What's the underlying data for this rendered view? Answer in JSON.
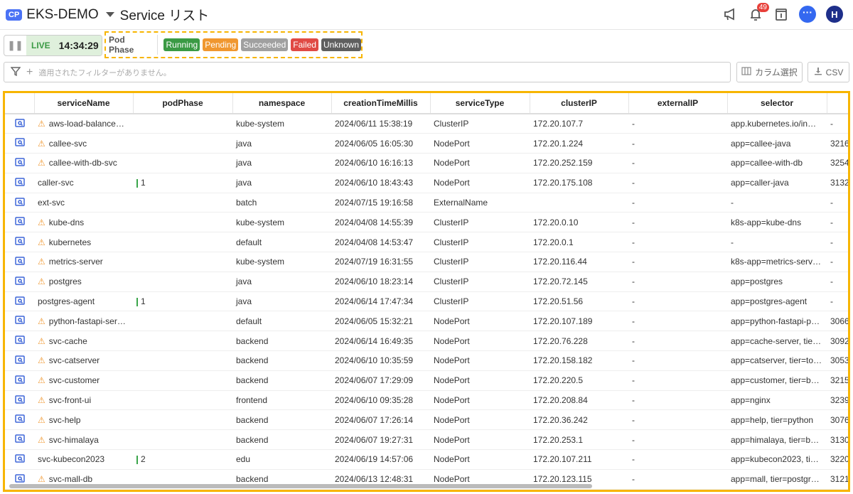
{
  "header": {
    "badge": "CP",
    "project": "EKS-DEMO",
    "title": "Service リスト",
    "notification_count": "49",
    "avatar": "H"
  },
  "live": {
    "label": "LIVE",
    "time": "14:34:29"
  },
  "pod_phase": {
    "label": "Pod Phase",
    "chips": [
      {
        "label": "Running",
        "color": "#3a9a44"
      },
      {
        "label": "Pending",
        "color": "#f0972f"
      },
      {
        "label": "Succeeded",
        "color": "#a0a0a0"
      },
      {
        "label": "Failed",
        "color": "#e04a44"
      },
      {
        "label": "Unknown",
        "color": "#5f5f5f"
      }
    ]
  },
  "filter": {
    "placeholder": "適用されたフィルターがありません。"
  },
  "toolbar": {
    "columns_label": "カラム選択",
    "csv_label": "CSV"
  },
  "table": {
    "columns": [
      "",
      "serviceName",
      "podPhase",
      "namespace",
      "creationTimeMillis",
      "serviceType",
      "clusterIP",
      "externalIP",
      "selector",
      ""
    ],
    "rows": [
      {
        "warn": true,
        "name": "aws-load-balance…",
        "pod": "",
        "ns": "kube-system",
        "created": "2024/06/11 15:38:19",
        "type": "ClusterIP",
        "ip": "172.20.107.7",
        "ext": "-",
        "sel": "app.kubernetes.io/in…",
        "last": "-"
      },
      {
        "warn": true,
        "name": "callee-svc",
        "pod": "",
        "ns": "java",
        "created": "2024/06/05 16:05:30",
        "type": "NodePort",
        "ip": "172.20.1.224",
        "ext": "-",
        "sel": "app=callee-java",
        "last": "3216"
      },
      {
        "warn": true,
        "name": "callee-with-db-svc",
        "pod": "",
        "ns": "java",
        "created": "2024/06/10 16:16:13",
        "type": "NodePort",
        "ip": "172.20.252.159",
        "ext": "-",
        "sel": "app=callee-with-db",
        "last": "3254"
      },
      {
        "warn": false,
        "name": "caller-svc",
        "pod": "1",
        "ns": "java",
        "created": "2024/06/10 18:43:43",
        "type": "NodePort",
        "ip": "172.20.175.108",
        "ext": "-",
        "sel": "app=caller-java",
        "last": "3132"
      },
      {
        "warn": false,
        "name": "ext-svc",
        "pod": "",
        "ns": "batch",
        "created": "2024/07/15 19:16:58",
        "type": "ExternalName",
        "ip": "",
        "ext": "-",
        "sel": "-",
        "last": "-"
      },
      {
        "warn": true,
        "name": "kube-dns",
        "pod": "",
        "ns": "kube-system",
        "created": "2024/04/08 14:55:39",
        "type": "ClusterIP",
        "ip": "172.20.0.10",
        "ext": "-",
        "sel": "k8s-app=kube-dns",
        "last": "-"
      },
      {
        "warn": true,
        "name": "kubernetes",
        "pod": "",
        "ns": "default",
        "created": "2024/04/08 14:53:47",
        "type": "ClusterIP",
        "ip": "172.20.0.1",
        "ext": "-",
        "sel": "-",
        "last": "-"
      },
      {
        "warn": true,
        "name": "metrics-server",
        "pod": "",
        "ns": "kube-system",
        "created": "2024/07/19 16:31:55",
        "type": "ClusterIP",
        "ip": "172.20.116.44",
        "ext": "-",
        "sel": "k8s-app=metrics-serv…",
        "last": "-"
      },
      {
        "warn": true,
        "name": "postgres",
        "pod": "",
        "ns": "java",
        "created": "2024/06/10 18:23:14",
        "type": "ClusterIP",
        "ip": "172.20.72.145",
        "ext": "-",
        "sel": "app=postgres",
        "last": "-"
      },
      {
        "warn": false,
        "name": "postgres-agent",
        "pod": "1",
        "ns": "java",
        "created": "2024/06/14 17:47:34",
        "type": "ClusterIP",
        "ip": "172.20.51.56",
        "ext": "-",
        "sel": "app=postgres-agent",
        "last": "-"
      },
      {
        "warn": true,
        "name": "python-fastapi-ser…",
        "pod": "",
        "ns": "default",
        "created": "2024/06/05 15:32:21",
        "type": "NodePort",
        "ip": "172.20.107.189",
        "ext": "-",
        "sel": "app=python-fastapi-p…",
        "last": "3066"
      },
      {
        "warn": true,
        "name": "svc-cache",
        "pod": "",
        "ns": "backend",
        "created": "2024/06/14 16:49:35",
        "type": "NodePort",
        "ip": "172.20.76.228",
        "ext": "-",
        "sel": "app=cache-server, tie…",
        "last": "3092"
      },
      {
        "warn": true,
        "name": "svc-catserver",
        "pod": "",
        "ns": "backend",
        "created": "2024/06/10 10:35:59",
        "type": "NodePort",
        "ip": "172.20.158.182",
        "ext": "-",
        "sel": "app=catserver, tier=to…",
        "last": "3053"
      },
      {
        "warn": true,
        "name": "svc-customer",
        "pod": "",
        "ns": "backend",
        "created": "2024/06/07 17:29:09",
        "type": "NodePort",
        "ip": "172.20.220.5",
        "ext": "-",
        "sel": "app=customer, tier=b…",
        "last": "3215"
      },
      {
        "warn": true,
        "name": "svc-front-ui",
        "pod": "",
        "ns": "frontend",
        "created": "2024/06/10 09:35:28",
        "type": "NodePort",
        "ip": "172.20.208.84",
        "ext": "-",
        "sel": "app=nginx",
        "last": "3239"
      },
      {
        "warn": true,
        "name": "svc-help",
        "pod": "",
        "ns": "backend",
        "created": "2024/06/07 17:26:14",
        "type": "NodePort",
        "ip": "172.20.36.242",
        "ext": "-",
        "sel": "app=help, tier=python",
        "last": "3076"
      },
      {
        "warn": true,
        "name": "svc-himalaya",
        "pod": "",
        "ns": "backend",
        "created": "2024/06/07 19:27:31",
        "type": "NodePort",
        "ip": "172.20.253.1",
        "ext": "-",
        "sel": "app=himalaya, tier=b…",
        "last": "3130"
      },
      {
        "warn": false,
        "name": "svc-kubecon2023",
        "pod": "2",
        "ns": "edu",
        "created": "2024/06/19 14:57:06",
        "type": "NodePort",
        "ip": "172.20.107.211",
        "ext": "-",
        "sel": "app=kubecon2023, ti…",
        "last": "3220"
      },
      {
        "warn": true,
        "name": "svc-mall-db",
        "pod": "",
        "ns": "backend",
        "created": "2024/06/13 12:48:31",
        "type": "NodePort",
        "ip": "172.20.123.115",
        "ext": "-",
        "sel": "app=mall, tier=postgr…",
        "last": "3121"
      }
    ]
  }
}
